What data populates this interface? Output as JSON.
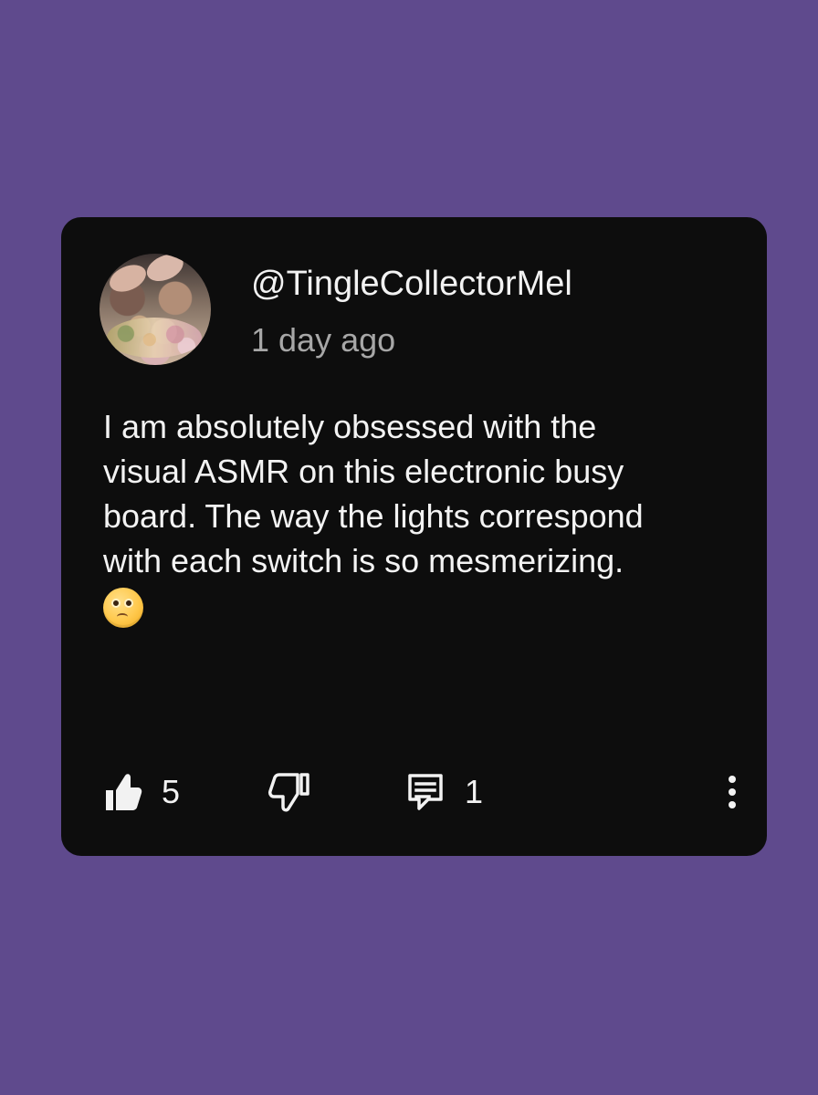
{
  "comment_card": {
    "username": "@TingleCollectorMel",
    "timestamp": "1 day ago",
    "text": "I am absolutely obsessed with the\nvisual ASMR on this electronic busy\nboard. The way the lights correspond\nwith each switch is so mesmerizing.",
    "emoji": "🥺"
  },
  "actions": {
    "like_count": "5",
    "reply_count": "1"
  },
  "icons": {
    "avatar": "avatar-image",
    "like": "thumbs-up-icon",
    "dislike": "thumbs-down-icon",
    "reply": "comment-icon",
    "more": "more-vertical-icon"
  },
  "colors": {
    "page_background": "#5f4a8d",
    "card_background": "#0d0d0d",
    "primary_text": "#f2f2f2",
    "secondary_text": "#a7a7a7"
  }
}
